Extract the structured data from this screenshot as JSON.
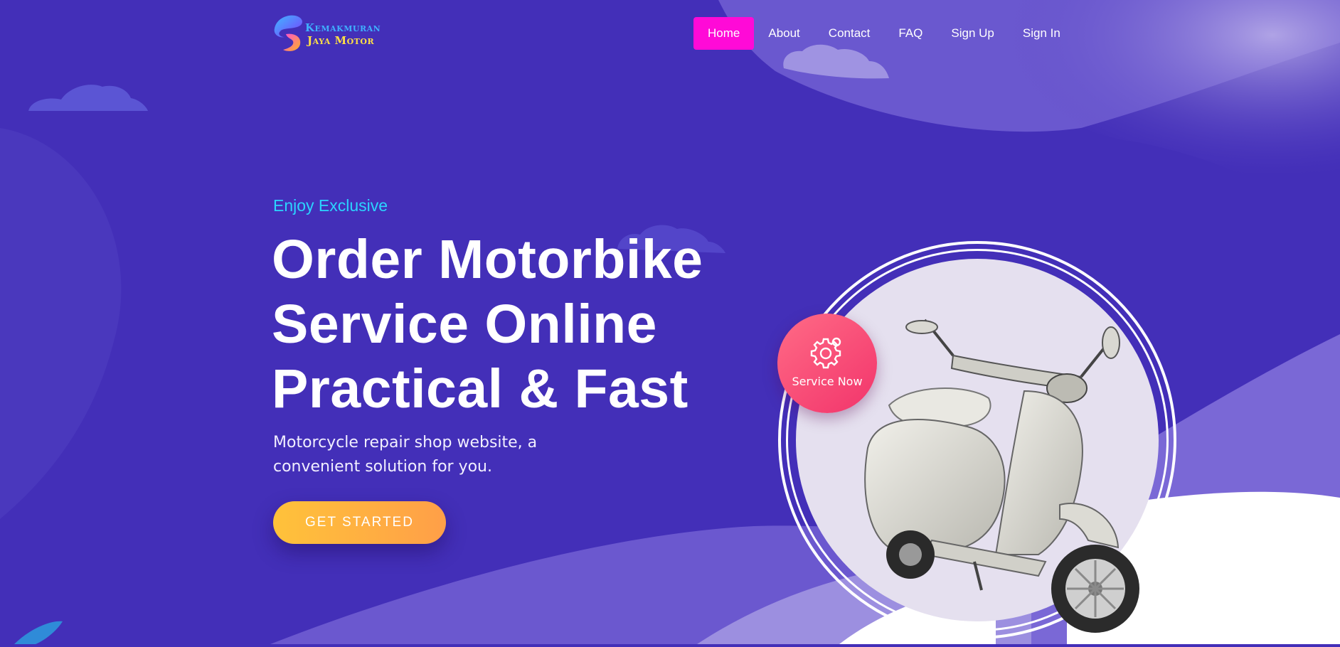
{
  "brand": {
    "name_line1": "Kemakmuran",
    "name_line2": "Jaya Motor"
  },
  "nav": {
    "items": [
      {
        "label": "Home",
        "active": true
      },
      {
        "label": "About",
        "active": false
      },
      {
        "label": "Contact",
        "active": false
      },
      {
        "label": "FAQ",
        "active": false
      },
      {
        "label": "Sign Up",
        "active": false
      },
      {
        "label": "Sign In",
        "active": false
      }
    ]
  },
  "hero": {
    "eyebrow": "Enjoy Exclusive",
    "headline_lines": [
      "Order Motorbike",
      "Service Online",
      "Practical & Fast"
    ],
    "subtitle": "Motorcycle repair shop website, a convenient solution for you.",
    "cta_label": "GET STARTED"
  },
  "badge": {
    "icon": "gear-icon",
    "label": "Service Now"
  },
  "colors": {
    "background": "#432fb8",
    "nav_active": "#ff0ad7",
    "eyebrow": "#2bd4ff",
    "cta": "#ffb340",
    "badge": "#f5466f"
  }
}
